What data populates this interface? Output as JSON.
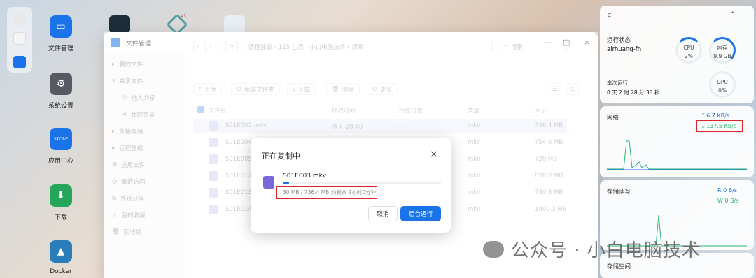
{
  "desktop": {
    "icons": [
      {
        "label": "文件管理",
        "color": "#1a73e8"
      },
      {
        "label": "系统设置",
        "color": "#555a63"
      },
      {
        "label": "应用中心",
        "color": "#1a73e8",
        "badge": "STORE"
      },
      {
        "label": "下载",
        "color": "#26a65b"
      },
      {
        "label": "Docker",
        "color": "#2a7db8"
      }
    ],
    "top_icon_label": "V3"
  },
  "window": {
    "title": "文件管理",
    "sidebar": [
      "我的文件",
      "共享文件",
      "他人共享",
      "我的共享",
      "外接存储",
      "远程挂载",
      "应用文件",
      "最近访问",
      "外链分享",
      "我的收藏",
      "回收站"
    ],
    "breadcrumb": "远程挂载 › 115 生活 - 小白电脑技术 › 视频",
    "search_placeholder": "搜索",
    "toolbar": [
      "上传",
      "新建文件夹",
      "下载",
      "删除",
      "更多"
    ],
    "columns": [
      "文件名",
      "修改时间",
      "所在位置",
      "类型",
      "大小"
    ],
    "rows": [
      {
        "name": "S01E003.mkv",
        "time": "今天 20:40",
        "loc": "-",
        "type": "mkv",
        "size": "736.4 MB"
      },
      {
        "name": "S01E004",
        "time": "",
        "loc": "",
        "type": "mkv",
        "size": "754.6 MB"
      },
      {
        "name": "S01E005",
        "time": "",
        "loc": "",
        "type": "mkv",
        "size": "720 MB"
      },
      {
        "name": "S01E012",
        "time": "",
        "loc": "",
        "type": "mkv",
        "size": "826.8 MB"
      },
      {
        "name": "S01E013",
        "time": "",
        "loc": "",
        "type": "mkv",
        "size": "730.8 MB"
      },
      {
        "name": "S01E014",
        "time": "",
        "loc": "",
        "type": "mkv",
        "size": "1000.3 MB"
      }
    ]
  },
  "dialog": {
    "title": "正在复制中",
    "file": "S01E003.mkv",
    "progress_text": "30 MB / 736.4 MB 约剩余 2小时0分钟",
    "progress_fraction": 0.04,
    "cancel": "取消",
    "background": "后台运行"
  },
  "panel": {
    "status_title": "运行状态",
    "host": "airhuang-fn",
    "uptime_label": "本次运行",
    "uptime": "0 天 2 时 28 分 38 秒",
    "cpu_label": "CPU",
    "cpu": "2%",
    "mem_label": "内存",
    "mem": "9.9 GB",
    "gpu_label": "GPU",
    "gpu": "0%",
    "net_title": "网络",
    "net_up": "6.7 KB/s",
    "net_down": "137.5 KB/s",
    "disk_title": "存储读写",
    "disk_r": "R 0 B/s",
    "disk_w": "W 0 B/s",
    "space_title": "存储空间"
  },
  "watermark": "公众号 · 小白电脑技术",
  "colors": {
    "accent": "#1a73e8",
    "green": "#2bb673",
    "highlight": "#e0242c"
  }
}
